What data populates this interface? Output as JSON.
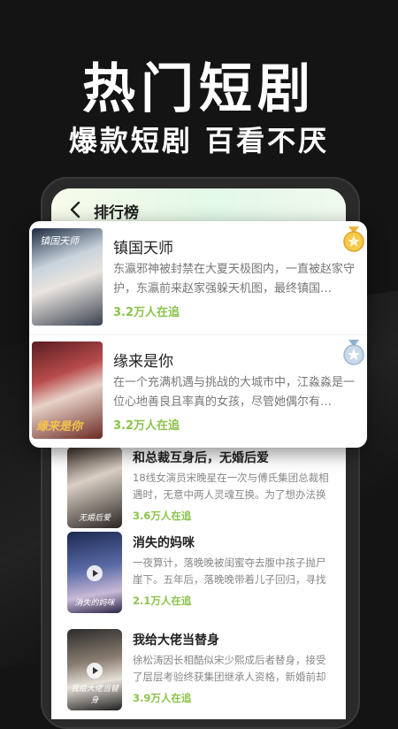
{
  "hero": {
    "title": "热门短剧",
    "subtitle": "爆款短剧 百看不厌"
  },
  "screen": {
    "header_title": "排行榜",
    "back_icon": "chevron-left-icon"
  },
  "featured": [
    {
      "title": "镇国天师",
      "description": "东瀛邪神被封禁在大夏天极图内，一直被赵家守护，东瀛前来赵家强躲天机图，最终镇国…",
      "viewers": "3.2万人在追",
      "medal": "gold-medal-icon",
      "poster_text": "镇国天师"
    },
    {
      "title": "缘来是你",
      "description": "在一个充满机遇与挑战的大城市中，江淼淼是一位心地善良且率真的女孩，尽管她偶尔有…",
      "viewers": "3.2万人在追",
      "medal": "silver-medal-icon",
      "poster_text": "缘来是你"
    }
  ],
  "list": [
    {
      "title": "和总裁互身后，无婚后爱",
      "description": "18线女演员宋晚星在一次与傅氏集团总裁相遇时，无意中两人灵魂互换。为了想办法换回…",
      "viewers": "3.6万人在追",
      "poster_text": "无婚后爱"
    },
    {
      "title": "消失的妈咪",
      "description": "一夜算计，落晚晚被闺蜜夺去腹中孩子抛尸崖下。五年后，落晚晚带着儿子回归，寻找孩…",
      "viewers": "2.1万人在追",
      "poster_text": "消失的妈咪"
    },
    {
      "title": "我给大佬当替身",
      "description": "徐松涛因长相酷似宋少熙成后者替身，接受了层层考验终获集团继承人资格，新婚前却被…",
      "viewers": "3.9万人在追",
      "poster_text": "我给大佬当替身"
    }
  ],
  "colors": {
    "accent_green": "#8bc34a",
    "background": "#141414"
  }
}
